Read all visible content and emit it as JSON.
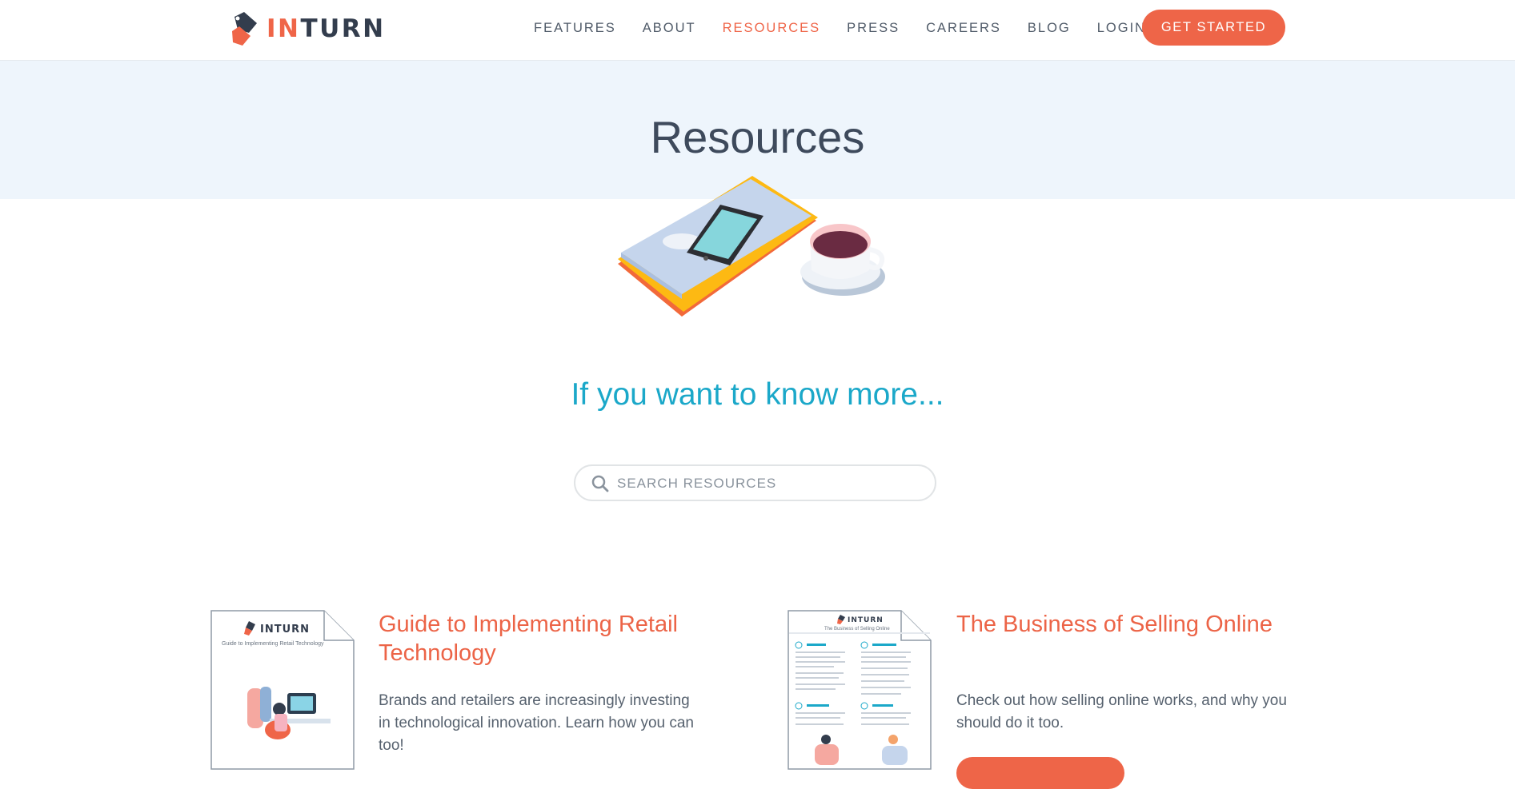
{
  "brand": {
    "name_part1": "IN",
    "name_part2": "TURN"
  },
  "nav": {
    "items": [
      {
        "label": "FEATURES"
      },
      {
        "label": "ABOUT"
      },
      {
        "label": "RESOURCES"
      },
      {
        "label": "PRESS"
      },
      {
        "label": "CAREERS"
      },
      {
        "label": "BLOG"
      },
      {
        "label": "LOGIN"
      }
    ],
    "cta_label": "GET STARTED"
  },
  "hero": {
    "title": "Resources"
  },
  "tagline": "If you want to know more...",
  "search": {
    "placeholder": "SEARCH RESOURCES",
    "value": ""
  },
  "resources": [
    {
      "title": "Guide to Implementing Retail Technology",
      "description": "Brands and retailers are increasingly investing in technological innovation. Learn how you can too!",
      "thumb_brand": "INTURN",
      "thumb_title": "Guide to Implementing Retail Technology"
    },
    {
      "title": "The Business of Selling Online",
      "description": "Check out how selling online works, and why you should do it too.",
      "thumb_brand": "INTURN",
      "thumb_title": "The Business of Selling Online"
    }
  ],
  "colors": {
    "accent": "#ee6548",
    "teal": "#1ba8c9",
    "hero_bg": "#eef5fc",
    "text": "#3e4a5c"
  },
  "icons": {
    "search": "search-icon",
    "logo": "inturn-tag-logo"
  }
}
